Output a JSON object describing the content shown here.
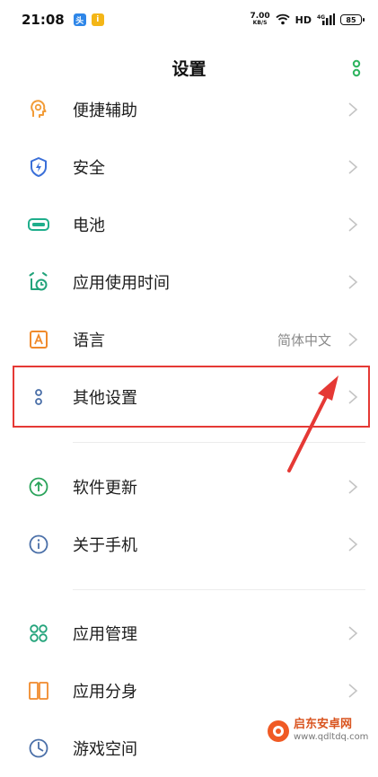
{
  "status_bar": {
    "time": "21:08",
    "chip1": "头",
    "chip2": "i",
    "net_speed": "7.00",
    "net_unit": "KB/S",
    "hd": "HD",
    "battery": "85"
  },
  "header": {
    "title": "设置"
  },
  "items": [
    {
      "label": "便捷辅助",
      "icon": "accessibility-head-icon",
      "color": "#f29c38"
    },
    {
      "label": "安全",
      "icon": "shield-lightning-icon",
      "color": "#3a6fd8"
    },
    {
      "label": "电池",
      "icon": "battery-icon",
      "color": "#1fae8c"
    },
    {
      "label": "应用使用时间",
      "icon": "alarm-clock-icon",
      "color": "#22a37a"
    },
    {
      "label": "语言",
      "value": "简体中文",
      "icon": "letter-a-icon",
      "color": "#f08a2c"
    },
    {
      "label": "其他设置",
      "icon": "two-dots-icon",
      "color": "#4a6fa8"
    },
    {
      "label": "软件更新",
      "icon": "upload-circle-icon",
      "color": "#2aa35a"
    },
    {
      "label": "关于手机",
      "icon": "info-circle-icon",
      "color": "#4a6fa8"
    },
    {
      "label": "应用管理",
      "icon": "grid-four-icon",
      "color": "#22a37a"
    },
    {
      "label": "应用分身",
      "icon": "dual-rectangles-icon",
      "color": "#f08a2c"
    },
    {
      "label": "游戏空间",
      "icon": "game-icon",
      "color": "#4a6fa8"
    }
  ],
  "watermark": {
    "name": "启东安卓网",
    "url": "www.qdltdq.com"
  },
  "colors": {
    "annotation_red": "#e53935",
    "accent_green": "#2fb45f"
  }
}
